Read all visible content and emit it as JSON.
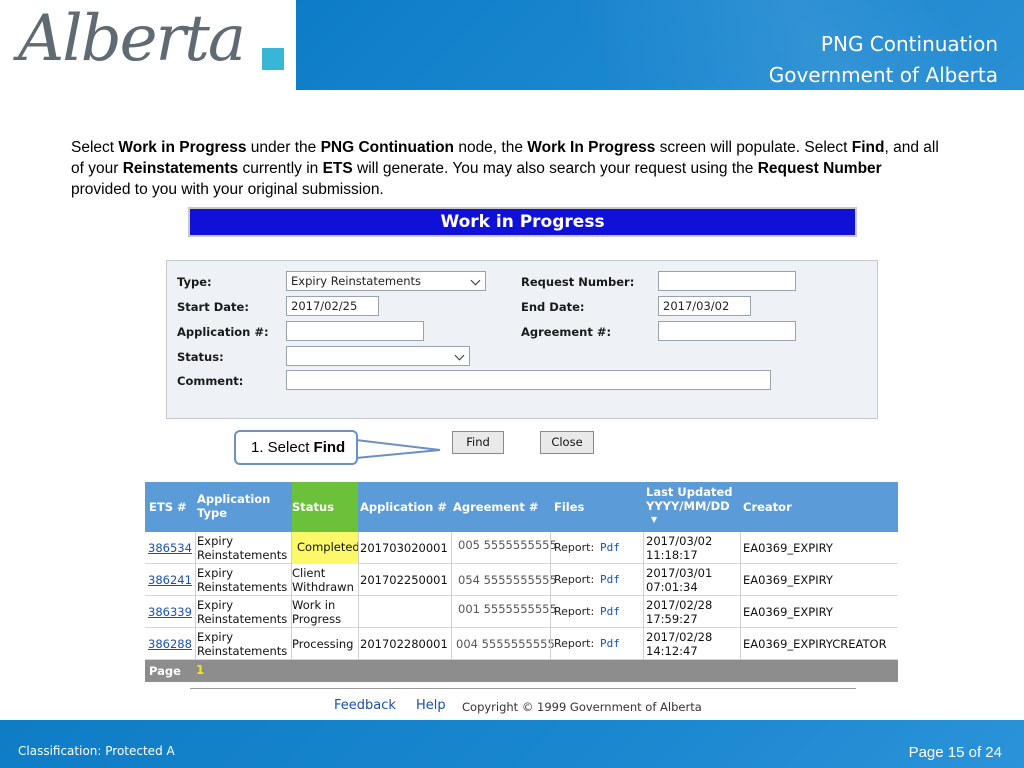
{
  "brand": {
    "logo_text": "Alberta",
    "accent_color": "#38b6d6",
    "band_color": "#1a86cf"
  },
  "header": {
    "line1": "PNG Continuation",
    "line2": "Government of Alberta"
  },
  "intro": {
    "p1": "Select ",
    "b1": "Work in Progress",
    "p2": " under the ",
    "b2": "PNG Continuation",
    "p3": " node, the ",
    "b3": "Work In Progress",
    "p4": " screen will populate. Select ",
    "b4": "Find",
    "p5": ", and all of your ",
    "b5": "Reinstatements",
    "p6": " currently in ",
    "b6": "ETS",
    "p7": " will generate. You may also search your request using the ",
    "b7": "Request Number",
    "p8": " provided to you with your original submission."
  },
  "wip_title": "Work in Progress",
  "form": {
    "type_label": "Type:",
    "type_value": "Expiry Reinstatements",
    "start_label": "Start Date:",
    "start_value": "2017/02/25",
    "app_label": "Application #:",
    "app_value": "",
    "status_label": "Status:",
    "status_value": "",
    "comment_label": "Comment:",
    "comment_value": "",
    "req_label": "Request Number:",
    "req_value": "",
    "end_label": "End Date:",
    "end_value": "2017/03/02",
    "agr_label": "Agreement #:",
    "agr_value": ""
  },
  "buttons": {
    "find": "Find",
    "close": "Close"
  },
  "callout": {
    "prefix": "1. Select ",
    "bold": "Find"
  },
  "table": {
    "headers": {
      "ets": "ETS #",
      "apptype": [
        "Application",
        "Type"
      ],
      "status": "Status",
      "appno": "Application #",
      "agr": "Agreement #",
      "files": "Files",
      "updated": [
        "Last Updated",
        "YYYY/MM/DD"
      ],
      "creator": "Creator"
    },
    "rows": [
      {
        "ets": "386534",
        "type": [
          "Expiry",
          "Reinstatements"
        ],
        "status": [
          "Completed"
        ],
        "appno": "201703020001",
        "agr": "005 5555555555",
        "report": "Report:",
        "pdf": "Pdf",
        "date": "2017/03/02",
        "time": "11:18:17",
        "creator": "EA0369_EXPIRY"
      },
      {
        "ets": "386241",
        "type": [
          "Expiry",
          "Reinstatements"
        ],
        "status": [
          "Client",
          "Withdrawn"
        ],
        "appno": "201702250001",
        "agr": "054 5555555555",
        "report": "Report:",
        "pdf": "Pdf",
        "date": "2017/03/01",
        "time": "07:01:34",
        "creator": "EA0369_EXPIRY"
      },
      {
        "ets": "386339",
        "type": [
          "Expiry",
          "Reinstatements"
        ],
        "status": [
          "Work in",
          "Progress"
        ],
        "appno": "",
        "agr": "001 5555555555",
        "report": "Report:",
        "pdf": "Pdf",
        "date": "2017/02/28",
        "time": "17:59:27",
        "creator": "EA0369_EXPIRY"
      },
      {
        "ets": "386288",
        "type": [
          "Expiry",
          "Reinstatements"
        ],
        "status": [
          "Processing"
        ],
        "appno": "201702280001",
        "agr": "004 5555555555",
        "report": "Report:",
        "pdf": "Pdf",
        "date": "2017/02/28",
        "time": "14:12:47",
        "creator": "EA0369_EXPIRYCREATOR"
      }
    ],
    "page_label": "Page",
    "page_number": "1"
  },
  "page_footer": {
    "feedback": "Feedback",
    "help": "Help",
    "copyright": "Copyright © 1999 Government of Alberta"
  },
  "slide_footer": {
    "classification": "Classification: Protected A",
    "page": "Page 15 of 24"
  }
}
